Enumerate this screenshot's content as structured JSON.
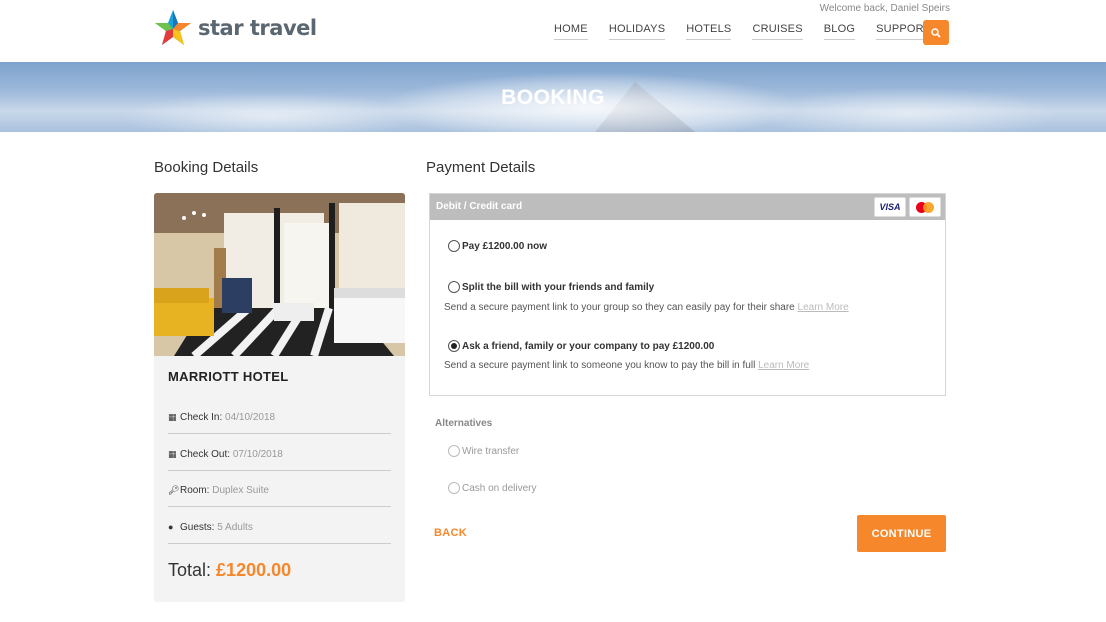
{
  "header": {
    "brand": "star travel",
    "welcome": "Welcome back, Daniel Speirs",
    "nav": [
      "HOME",
      "HOLIDAYS",
      "HOTELS",
      "CRUISES",
      "BLOG",
      "SUPPORT"
    ],
    "search_icon": "search-icon",
    "accent": "#f6872b"
  },
  "banner": {
    "title": "BOOKING"
  },
  "booking": {
    "heading": "Booking Details",
    "hotel_name": "MARRIOTT HOTEL",
    "check_in_label": "Check In:",
    "check_in": "04/10/2018",
    "check_out_label": "Check Out:",
    "check_out": "07/10/2018",
    "room_label": "Room:",
    "room": "Duplex Suite",
    "guests_label": "Guests:",
    "guests": "5 Adults",
    "total_label": "Total:",
    "total": "£1200.00"
  },
  "payment": {
    "heading": "Payment Details",
    "method_title": "Debit / Credit card",
    "card_logos": [
      "VISA",
      "mastercard"
    ],
    "options": [
      {
        "label": "Pay £1200.00 now",
        "sub": "",
        "checked": false
      },
      {
        "label": "Split the bill with your friends and family",
        "sub": "Send a secure payment link to your group so they can easily pay for their share",
        "link": "Learn More",
        "checked": false
      },
      {
        "label": "Ask a friend, family or your company to pay £1200.00",
        "sub": "Send a secure payment link to someone you know to pay the bill in full",
        "link": "Learn More",
        "checked": true
      }
    ],
    "alternatives_title": "Alternatives",
    "alternatives": [
      "Wire transfer",
      "Cash on delivery"
    ],
    "back_label": "BACK",
    "continue_label": "CONTINUE"
  }
}
